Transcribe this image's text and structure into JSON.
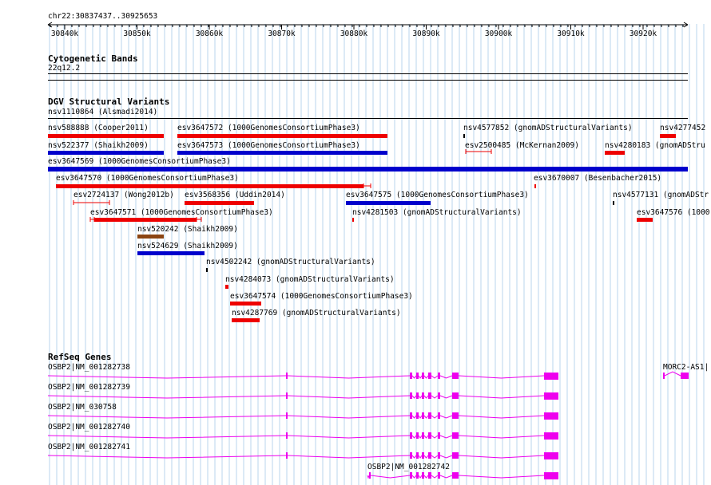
{
  "ruler": {
    "region": "chr22:30837437..30925653",
    "ticks": [
      "30840k",
      "30850k",
      "30860k",
      "30870k",
      "30880k",
      "30890k",
      "30900k",
      "30910k",
      "30920k"
    ]
  },
  "cytoband": {
    "title": "Cytogenetic Bands",
    "band": "22q12.2"
  },
  "dgv": {
    "title": "DGV Structural Variants",
    "features": [
      {
        "name": "nsv1110864 (Alsmadi2014)",
        "type": "label-only"
      },
      {
        "name": "nsv588888 (Cooper2011)",
        "type": "loss"
      },
      {
        "name": "esv3647572 (1000GenomesConsortiumPhase3)",
        "type": "loss"
      },
      {
        "name": "nsv4577852 (gnomADStructuralVariants)",
        "type": "small"
      },
      {
        "name": "nsv4277452",
        "type": "loss"
      },
      {
        "name": "nsv522377 (Shaikh2009)",
        "type": "gain"
      },
      {
        "name": "esv3647573 (1000GenomesConsortiumPhase3)",
        "type": "gain"
      },
      {
        "name": "esv2500485 (McKernan2009)",
        "type": "loss-line"
      },
      {
        "name": "nsv4280183 (gnomADStru",
        "type": "loss"
      },
      {
        "name": "esv3647569 (1000GenomesConsortiumPhase3)",
        "type": "gain"
      },
      {
        "name": "esv3647570 (1000GenomesConsortiumPhase3)",
        "type": "loss"
      },
      {
        "name": "esv3670007 (Besenbacher2015)",
        "type": "small"
      },
      {
        "name": "esv2724137 (Wong2012b)",
        "type": "loss-line"
      },
      {
        "name": "esv3568356 (Uddin2014)",
        "type": "loss"
      },
      {
        "name": "esv3647575 (1000GenomesConsortiumPhase3)",
        "type": "gain"
      },
      {
        "name": "nsv4577131 (gnomADStr",
        "type": "small"
      },
      {
        "name": "esv3647571 (1000GenomesConsortiumPhase3)",
        "type": "loss"
      },
      {
        "name": "nsv4281503 (gnomADStructuralVariants)",
        "type": "small"
      },
      {
        "name": "esv3647576 (1000",
        "type": "loss"
      },
      {
        "name": "nsv520242 (Shaikh2009)",
        "type": "complex"
      },
      {
        "name": "nsv524629 (Shaikh2009)",
        "type": "gain"
      },
      {
        "name": "nsv4502242 (gnomADStructuralVariants)",
        "type": "small"
      },
      {
        "name": "nsv4284073 (gnomADStructuralVariants)",
        "type": "loss"
      },
      {
        "name": "esv3647574 (1000GenomesConsortiumPhase3)",
        "type": "loss"
      },
      {
        "name": "nsv4287769 (gnomADStructuralVariants)",
        "type": "loss"
      }
    ]
  },
  "refseq": {
    "title": "RefSeq Genes",
    "genes": [
      "OSBP2|NM_001282738",
      "OSBP2|NM_001282739",
      "OSBP2|NM_030758",
      "OSBP2|NM_001282740",
      "OSBP2|NM_001282741",
      "OSBP2|NM_001282742",
      "MORC2-AS1|"
    ]
  },
  "colors": {
    "loss": "#ee0000",
    "gain": "#0000cc",
    "complex": "#8b4513",
    "gene": "#ee00ee",
    "grid": "#b8d4ee"
  }
}
